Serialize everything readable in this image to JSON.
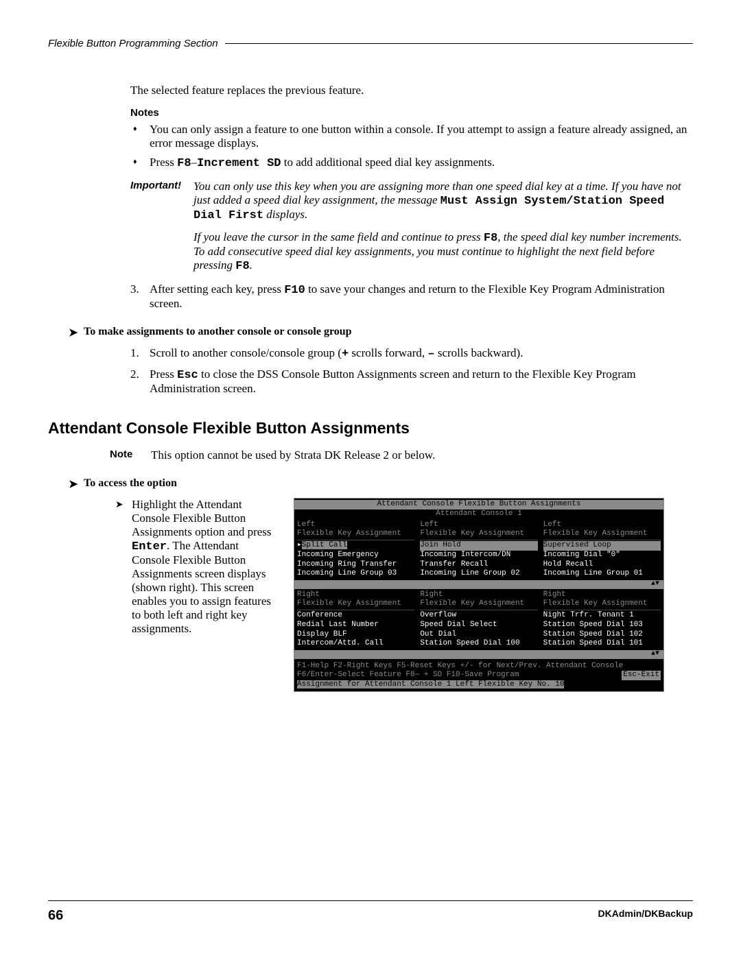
{
  "header": {
    "section": "Flexible Button Programming Section"
  },
  "intro": {
    "text": "The selected feature replaces the previous feature."
  },
  "notes": {
    "label": "Notes",
    "bullet1": "You can only assign a feature to one button within a console. If you attempt to assign a feature already assigned, an error message displays.",
    "bullet2_pre": "Press ",
    "bullet2_key": "F8",
    "bullet2_dash": "–",
    "bullet2_cmd": "Increment SD",
    "bullet2_post": " to add additional speed dial key assignments."
  },
  "important": {
    "label": "Important!",
    "p1a": "You can only use this key when you are assigning more than one speed dial key at a time. If you have not just added a speed dial key assignment, the message ",
    "p1b": "Must Assign System/Station Speed Dial First",
    "p1c": " displays.",
    "p2a": "If you leave the cursor in the same field and continue to press ",
    "p2key1": "F8",
    "p2b": ", the speed dial key number increments. To add consecutive speed dial key assignments, you must continue to highlight the next field before pressing ",
    "p2key2": "F8",
    "p2c": "."
  },
  "step3": {
    "num": "3.",
    "a": "After setting each key, press ",
    "key": "F10",
    "b": " to save your changes and return to the Flexible Key Program Administration screen."
  },
  "arrow1": {
    "text": "To make assignments to another console or console group"
  },
  "sub1": {
    "n1": "1.",
    "t1a": "Scroll to another console/console group (",
    "t1plus": "+",
    "t1b": " scrolls forward, ",
    "t1minus": "–",
    "t1c": "  scrolls backward).",
    "n2": "2.",
    "t2a": "Press ",
    "t2key": "Esc",
    "t2b": " to close the DSS Console Button Assignments screen and return to the Flexible Key Program Administration screen."
  },
  "section2": {
    "title": "Attendant Console Flexible Button Assignments"
  },
  "note2": {
    "label": "Note",
    "text": "This option cannot be used by Strata DK Release 2 or below."
  },
  "arrow2": {
    "text": "To access the option"
  },
  "access": {
    "t1": "Highlight the Attendant Console Flexible Button Assignments option and press ",
    "key": "Enter",
    "t2": ". The Attendant Console Flexible Button Assignments screen displays (shown right). This screen enables you to assign features to both left and right key assignments."
  },
  "terminal": {
    "title": "Attendant Console Flexible Button Assignments",
    "subtitle": "Attendant Console 1",
    "cols": {
      "left": {
        "h1": "Left",
        "h2": "Flexible Key Assignment",
        "top": [
          "Split Call",
          "Incoming Emergency",
          "Incoming Ring Transfer",
          "Incoming Line Group 03"
        ],
        "rh1": "Right",
        "rh2": "Flexible Key Assignment",
        "bot": [
          "Conference",
          "Redial Last Number",
          "Display BLF",
          "Intercom/Attd. Call"
        ]
      },
      "mid": {
        "h1": "Left",
        "h2": "Flexible Key Assignment",
        "top": [
          "Join Hold",
          "Incoming Intercom/DN",
          "Transfer Recall",
          "Incoming Line Group 02"
        ],
        "rh1": "Right",
        "rh2": "Flexible Key Assignment",
        "bot": [
          "Overflow",
          "Speed Dial Select",
          "Out Dial",
          "Station Speed Dial 100"
        ]
      },
      "right": {
        "h1": "Left",
        "h2": "Flexible Key Assignment",
        "top": [
          "Supervised Loop",
          "Incoming Dial \"0\"",
          "Hold Recall",
          "Incoming Line Group 01"
        ],
        "rh1": "Right",
        "rh2": "Flexible Key Assignment",
        "bot": [
          "Night Trfr. Tenant 1",
          "Station Speed Dial 103",
          "Station Speed Dial 102",
          "Station Speed Dial 101"
        ]
      }
    },
    "scroll": "▲▼",
    "footer1_left": "F1-Help  F2-Right Keys  F5-Reset Keys  +/- for Next/Prev. Attendant Console",
    "footer2_left": "F6/Enter-Select Feature  F8— + SD  F10-Save Program",
    "footer2_right": "Esc-Exit",
    "footer3": "Assignment for Attendant Console 1  Left Flexible Key No. 10"
  },
  "footer": {
    "page": "66",
    "right": "DKAdmin/DKBackup"
  }
}
